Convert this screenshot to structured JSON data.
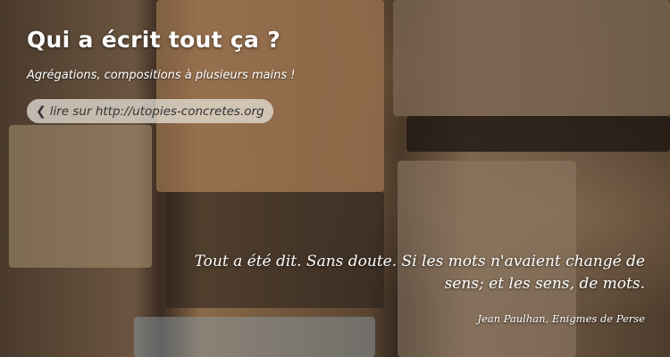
{
  "header": {
    "title": "Qui a écrit tout ça ?",
    "subtitle": "Agrégations, compositions à plusieurs mains !",
    "link_label": "lire sur http://utopies-concretes.org",
    "link_icon": "chevron-left-icon"
  },
  "quote": {
    "text": "Tout a été dit. Sans doute. Si les mots n'avaient changé de sens; et les sens, de mots.",
    "author": "Jean Paulhan, Enigmes de Perse"
  }
}
